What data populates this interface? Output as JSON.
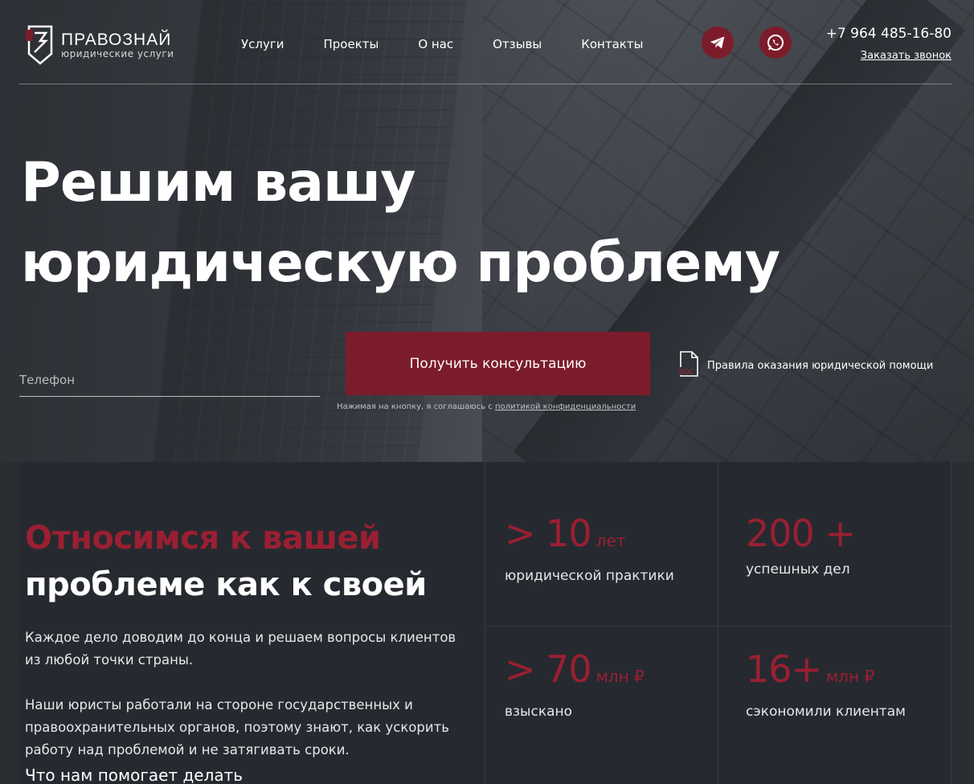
{
  "brand": {
    "name": "ПРАВОЗНАЙ",
    "subtitle": "юридические услуги",
    "accent_color": "#7c1c2b"
  },
  "nav": {
    "items": [
      "Услуги",
      "Проекты",
      "О нас",
      "Отзывы",
      "Контакты"
    ]
  },
  "social": {
    "telegram_icon": "telegram-icon",
    "whatsapp_icon": "whatsapp-icon"
  },
  "contact": {
    "phone": "+7 964 485-16-80",
    "callback_label": "Заказать звонок"
  },
  "hero": {
    "title_line1": "Решим вашу",
    "title_line2": "юридическую проблему",
    "phone_placeholder": "Телефон",
    "cta_label": "Получить консультацию",
    "consent_text": "Нажимая на кнопку, я соглашаюсь с",
    "consent_link": "политикой конфиденциальности",
    "rules_label": "Правила оказания юридической помощи",
    "rules_icon_text": "DOC"
  },
  "about": {
    "title_red": "Относимся к вашей",
    "title_white": "проблеме как к своей",
    "paragraph1": "Каждое дело доводим до конца и решаем вопросы клиентов из любой точки страны.",
    "paragraph2": "Наши юристы работали на стороне государственных и правоохранительных органов, поэтому знают, как ускорить работу над проблемой и не затягивать сроки.",
    "more_label": "Что нам помогает делать"
  },
  "stats": [
    {
      "value": "> 10",
      "unit": "лет",
      "label": "юридической практики"
    },
    {
      "value": "200 +",
      "unit": "",
      "label": "успешных дел"
    },
    {
      "value": "> 70",
      "unit": "млн ₽",
      "label": "взыскано"
    },
    {
      "value": "16+",
      "unit": "млн ₽",
      "label": "сэкономили клиентам"
    }
  ]
}
